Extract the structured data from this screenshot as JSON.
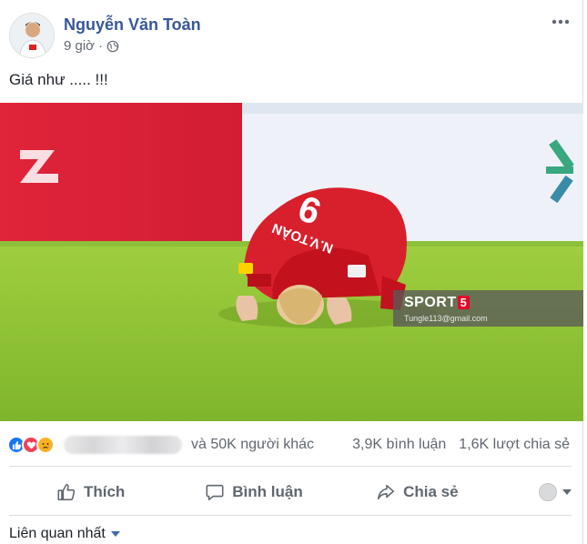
{
  "post": {
    "author": "Nguyễn Văn Toàn",
    "time": "9 giờ",
    "text": "Giá như ..... !!!"
  },
  "photo": {
    "jersey_number": "9",
    "jersey_name": "N.V.TOÀN",
    "watermark_brand": "SPORT",
    "watermark_number": "5",
    "watermark_email": "Tungle113@gmail.com"
  },
  "reactions": {
    "icons": [
      "like-icon",
      "love-icon",
      "sad-icon"
    ],
    "others_text": "và 50K người khác",
    "comments": "3,9K bình luận",
    "shares": "1,6K lượt chia sẻ"
  },
  "actions": {
    "like": "Thích",
    "comment": "Bình luận",
    "share": "Chia sẻ"
  },
  "comments": {
    "sort_label": "Liên quan nhất"
  },
  "colors": {
    "author_link": "#385898",
    "secondary_text": "#606770",
    "like_blue": "#1877f2",
    "love_red": "#f33e58",
    "sad_yellow": "#f7b125"
  }
}
